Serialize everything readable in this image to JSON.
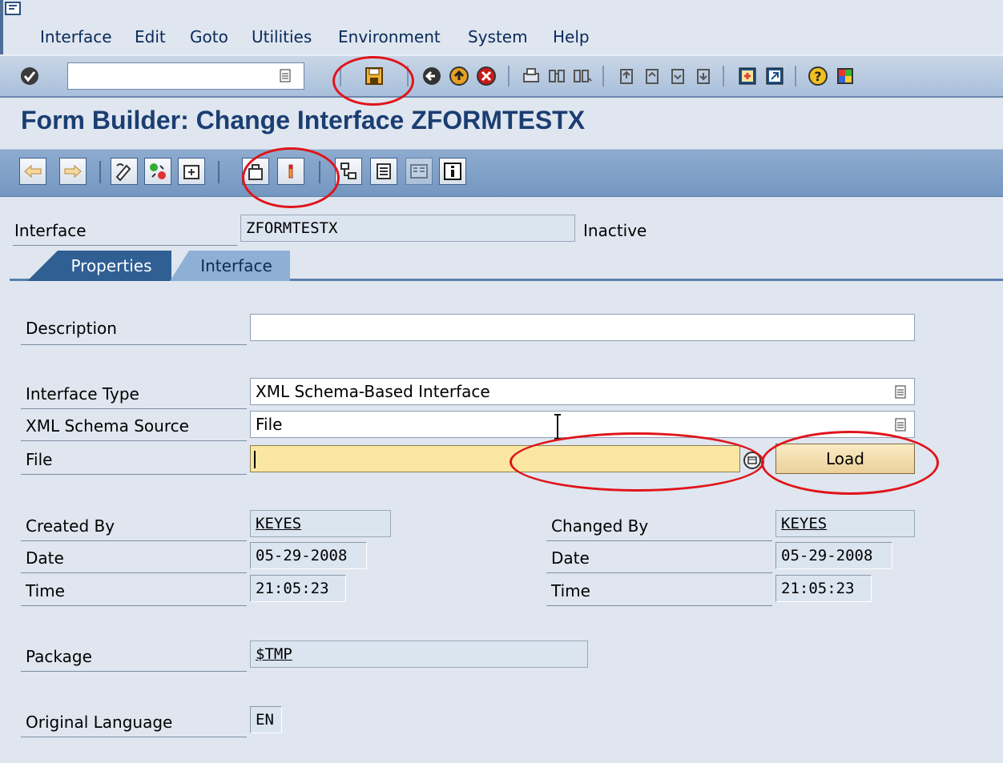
{
  "menu": {
    "items": [
      "Interface",
      "Edit",
      "Goto",
      "Utilities",
      "Environment",
      "System",
      "Help"
    ]
  },
  "toolbar": {
    "command_field": "",
    "icons": [
      "enter-icon",
      "save-icon",
      "back-icon",
      "exit-icon",
      "cancel-icon",
      "print-icon",
      "find-icon",
      "find-next-icon",
      "first-page-icon",
      "previous-page-icon",
      "next-page-icon",
      "last-page-icon",
      "create-session-icon",
      "shortcut-icon",
      "help-icon",
      "layout-menu-icon"
    ]
  },
  "page": {
    "title": "Form Builder: Change Interface ZFORMTESTX"
  },
  "header": {
    "interface_label": "Interface",
    "interface_value": "ZFORMTESTX",
    "status": "Inactive"
  },
  "tabs": [
    {
      "label": "Properties",
      "active": true
    },
    {
      "label": "Interface",
      "active": false
    }
  ],
  "form": {
    "description_label": "Description",
    "description_value": "",
    "interface_type_label": "Interface Type",
    "interface_type_value": "XML Schema-Based Interface",
    "schema_source_label": "XML Schema Source",
    "schema_source_value": "File",
    "file_label": "File",
    "file_value": "",
    "load_button": "Load",
    "created_by_label": "Created By",
    "created_by_value": "KEYES",
    "created_date_label": "Date",
    "created_date_value": "05-29-2008",
    "created_time_label": "Time",
    "created_time_value": "21:05:23",
    "changed_by_label": "Changed By",
    "changed_by_value": "KEYES",
    "changed_date_label": "Date",
    "changed_date_value": "05-29-2008",
    "changed_time_label": "Time",
    "changed_time_value": "21:05:23",
    "package_label": "Package",
    "package_value": "$TMP",
    "language_label": "Original Language",
    "language_value": "EN"
  },
  "colors": {
    "title": "#1b3e72",
    "tab_active": "#2f5f93",
    "tab_inactive": "#8fb0d6",
    "file_input": "#fbe6a2",
    "annotation": "#e0141a"
  }
}
